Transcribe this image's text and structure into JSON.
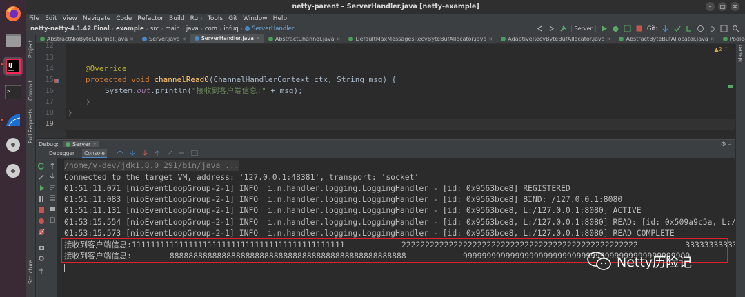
{
  "window": {
    "title": "netty-parent – ServerHandler.java [netty-example]"
  },
  "menu": [
    "File",
    "Edit",
    "View",
    "Navigate",
    "Code",
    "Refactor",
    "Build",
    "Run",
    "Tools",
    "Git",
    "Window",
    "Help"
  ],
  "breadcrumb": [
    "netty-netty-4.1.42.Final",
    "example",
    "src",
    "main",
    "java",
    "com",
    "infuq",
    "ServerHandler"
  ],
  "toolbar": {
    "run_config": "Server",
    "git_label": "Git:"
  },
  "tabs": [
    {
      "label": "AbstractNioByteChannel.java",
      "color": "#4a9c5a"
    },
    {
      "label": "Server.java",
      "color": "#4a88c7"
    },
    {
      "label": "ServerHandler.java",
      "color": "#4a88c7",
      "active": true
    },
    {
      "label": "AbstractChannel.java",
      "color": "#4a9c5a"
    },
    {
      "label": "DefaultMaxMessagesRecvByteBufAllocator.java",
      "color": "#4a9c5a"
    },
    {
      "label": "AdaptiveRecvByteBufAllocator.java",
      "color": "#4a9c5a"
    },
    {
      "label": "AbstractByteBufAllocator.java",
      "color": "#4a9c5a"
    },
    {
      "label": "PooledByteB",
      "color": "#4a9c5a"
    }
  ],
  "side_labels": {
    "project": "Project",
    "commit": "Commit",
    "pull_requests": "Pull Requests",
    "structure": "Structure",
    "maven": "Maven"
  },
  "editor": {
    "line_numbers": [
      "12",
      "13",
      "14",
      "15",
      "16",
      "17",
      "18",
      "19"
    ],
    "annotation": "@Override",
    "signature_kw": "protected void",
    "method_name": "channelRead0",
    "params": "(ChannelHandlerContext ctx, String msg) {",
    "println_prefix": "System.",
    "println_out": "out",
    "println_mid": ".println(",
    "println_str": "\"接收到客户端信息:\"",
    "println_rest": " + msg);",
    "close_brace_inner": "}",
    "close_brace_outer": "}",
    "inspection_count": "2"
  },
  "debug": {
    "label": "Debug:",
    "session": "Server",
    "tabs": [
      "Debugger",
      "Console"
    ]
  },
  "console_lines": [
    "/home/v-dev/jdk1.8.0_291/bin/java ...",
    "Connected to the target VM, address: '127.0.0.1:48381', transport: 'socket'",
    "01:51:11.071 [nioEventLoopGroup-2-1] INFO  i.n.handler.logging.LoggingHandler - [id: 0x9563bce8] REGISTERED",
    "01:51:11.083 [nioEventLoopGroup-2-1] INFO  i.n.handler.logging.LoggingHandler - [id: 0x9563bce8] BIND: /127.0.0.1:8080",
    "01:51:11.131 [nioEventLoopGroup-2-1] INFO  i.n.handler.logging.LoggingHandler - [id: 0x9563bce8, L:/127.0.0.1:8080] ACTIVE",
    "01:53:15.554 [nioEventLoopGroup-2-1] INFO  i.n.handler.logging.LoggingHandler - [id: 0x9563bce8, L:/127.0.0.1:8080] READ: [id: 0x509a9c5a, L:/127",
    "01:53:15.573 [nioEventLoopGroup-2-1] INFO  i.n.handler.logging.LoggingHandler - [id: 0x9563bce8, L:/127.0.0.1:8080] READ COMPLETE",
    "接收到客户端信息:111111111111111111111111111111111111111111111            22222222222222222222222222222222222222222222222222          3333333333333",
    "接收到客户端信息:        88888888888888888888888888888888888888888888888888            999999999999999999999999999999999999999999999999"
  ],
  "watermark": "Netty历险记"
}
